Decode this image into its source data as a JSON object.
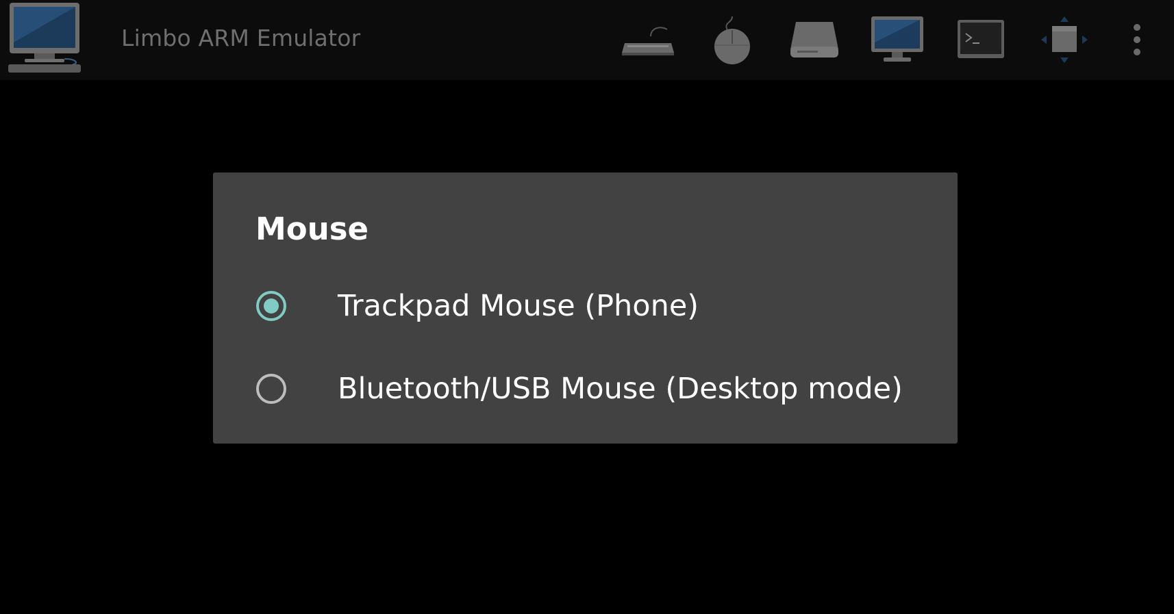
{
  "appbar": {
    "title": "Limbo ARM Emulator",
    "logo_icon": "desktop-computer-icon",
    "actions": [
      {
        "name": "keyboard-button",
        "icon": "keyboard-icon"
      },
      {
        "name": "mouse-button",
        "icon": "mouse-icon"
      },
      {
        "name": "drive-button",
        "icon": "hard-drive-icon"
      },
      {
        "name": "display-button",
        "icon": "monitor-icon"
      },
      {
        "name": "console-button",
        "icon": "terminal-icon"
      },
      {
        "name": "resize-button",
        "icon": "move-arrows-icon"
      },
      {
        "name": "overflow-menu-button",
        "icon": "more-vertical-icon"
      }
    ]
  },
  "dialog": {
    "title": "Mouse",
    "options": [
      {
        "label": "Trackpad Mouse (Phone)",
        "checked": true
      },
      {
        "label": "Bluetooth/USB Mouse (Desktop mode)",
        "checked": false
      }
    ]
  },
  "colors": {
    "background": "#000000",
    "appbar": "#0c0c0c",
    "dialog": "#424242",
    "accent": "#80cbc4",
    "radio_unchecked": "#bdbdbd"
  }
}
